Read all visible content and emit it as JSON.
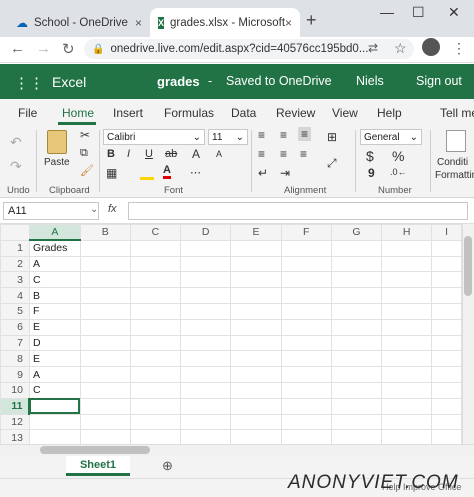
{
  "browser": {
    "tab1_title": "School - OneDrive",
    "tab2_title": "grades.xlsx - Microsoft",
    "tab_close": "×",
    "new_tab": "+",
    "minimize": "—",
    "maximize": "☐",
    "close": "✕",
    "url": "onedrive.live.com/edit.aspx?cid=40576cc195bd0..."
  },
  "excel": {
    "app_name": "Excel",
    "doc_name": "grades",
    "dash": "-",
    "save_status": "Saved to OneDrive",
    "user": "Niels",
    "sign_out": "Sign out"
  },
  "ribbon_tabs": [
    "File",
    "Home",
    "Insert",
    "Formulas",
    "Data",
    "Review",
    "View",
    "Help",
    "Tell me"
  ],
  "ribbon": {
    "undo_label": "Undo",
    "paste_label": "Paste",
    "clipboard_label": "Clipboard",
    "font_name": "Calibri",
    "font_size": "11",
    "font_label": "Font",
    "alignment_label": "Alignment",
    "number_format": "General",
    "number_label": "Number",
    "conditional_line1": "Conditi",
    "conditional_line2": "Formattin",
    "bold": "B",
    "italic": "I",
    "underline": "U",
    "strike": "ab",
    "grow": "A",
    "shrink": "A",
    "currency": "$",
    "percent": "%",
    "comma": "9"
  },
  "formula_bar": {
    "name_box": "A11",
    "fx": "fx",
    "formula": ""
  },
  "columns": [
    "A",
    "B",
    "C",
    "D",
    "E",
    "F",
    "G",
    "H",
    "I"
  ],
  "rows": [
    {
      "n": "1",
      "a": "Grades"
    },
    {
      "n": "2",
      "a": "A"
    },
    {
      "n": "3",
      "a": "C"
    },
    {
      "n": "4",
      "a": "B"
    },
    {
      "n": "5",
      "a": "F"
    },
    {
      "n": "6",
      "a": "E"
    },
    {
      "n": "7",
      "a": "D"
    },
    {
      "n": "8",
      "a": "E"
    },
    {
      "n": "9",
      "a": "A"
    },
    {
      "n": "10",
      "a": "C"
    },
    {
      "n": "11",
      "a": ""
    },
    {
      "n": "12",
      "a": ""
    },
    {
      "n": "13",
      "a": ""
    }
  ],
  "sheet": {
    "name": "Sheet1",
    "add": "⊕"
  },
  "status": {
    "help": "Help Improve Office"
  },
  "watermark": "ANONYVIET.COM",
  "colors": {
    "excel_green": "#217346"
  }
}
